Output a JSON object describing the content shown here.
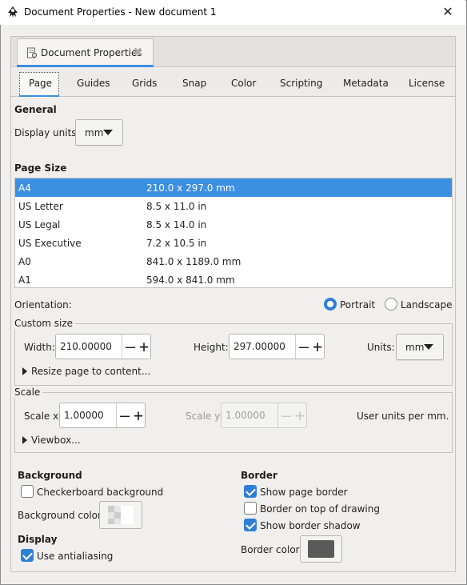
{
  "window": {
    "title": "Document Properties - New document 1",
    "close_glyph": "✕"
  },
  "doc_tab": {
    "label": "Document Properties",
    "close_glyph": "✖"
  },
  "tabs": [
    "Page",
    "Guides",
    "Grids",
    "Snap",
    "Color",
    "Scripting",
    "Metadata",
    "License"
  ],
  "active_tab": "Page",
  "general": {
    "heading": "General",
    "display_units_label": "Display units:",
    "display_units_value": "mm"
  },
  "page_size": {
    "heading": "Page Size",
    "rows": [
      {
        "name": "A4",
        "size": "210.0 x 297.0 mm",
        "selected": true
      },
      {
        "name": "US Letter",
        "size": "8.5 x 11.0 in",
        "selected": false
      },
      {
        "name": "US Legal",
        "size": "8.5 x 14.0 in",
        "selected": false
      },
      {
        "name": "US Executive",
        "size": "7.2 x 10.5 in",
        "selected": false
      },
      {
        "name": "A0",
        "size": "841.0 x 1189.0 mm",
        "selected": false
      },
      {
        "name": "A1",
        "size": "594.0 x 841.0 mm",
        "selected": false
      }
    ]
  },
  "orientation": {
    "label": "Orientation:",
    "portrait": "Portrait",
    "landscape": "Landscape",
    "selected": "Portrait"
  },
  "custom_size": {
    "title": "Custom size",
    "width_label": "Width:",
    "width_value": "210.00000",
    "height_label": "Height:",
    "height_value": "297.00000",
    "units_label": "Units:",
    "units_value": "mm",
    "resize_label": "Resize page to content..."
  },
  "scale": {
    "title": "Scale",
    "scale_x_label": "Scale x:",
    "scale_x_value": "1.00000",
    "scale_y_label": "Scale y:",
    "scale_y_value": "1.00000",
    "user_units_label": "User units per mm.",
    "viewbox_label": "Viewbox..."
  },
  "background": {
    "heading": "Background",
    "checkerboard_label": "Checkerboard background",
    "checkerboard_checked": false,
    "color_label": "Background color:"
  },
  "display": {
    "heading": "Display",
    "antialias_label": "Use antialiasing",
    "antialias_checked": true
  },
  "border": {
    "heading": "Border",
    "show_border_label": "Show page border",
    "show_border_checked": true,
    "on_top_label": "Border on top of drawing",
    "on_top_checked": false,
    "shadow_label": "Show border shadow",
    "shadow_checked": true,
    "color_label": "Border color:",
    "color_value": "#5a5a5a"
  },
  "glyphs": {
    "minus": "—",
    "plus": "+"
  },
  "colors": {
    "accent": "#3d8fe1",
    "check_accent": "#2f7fd5"
  }
}
